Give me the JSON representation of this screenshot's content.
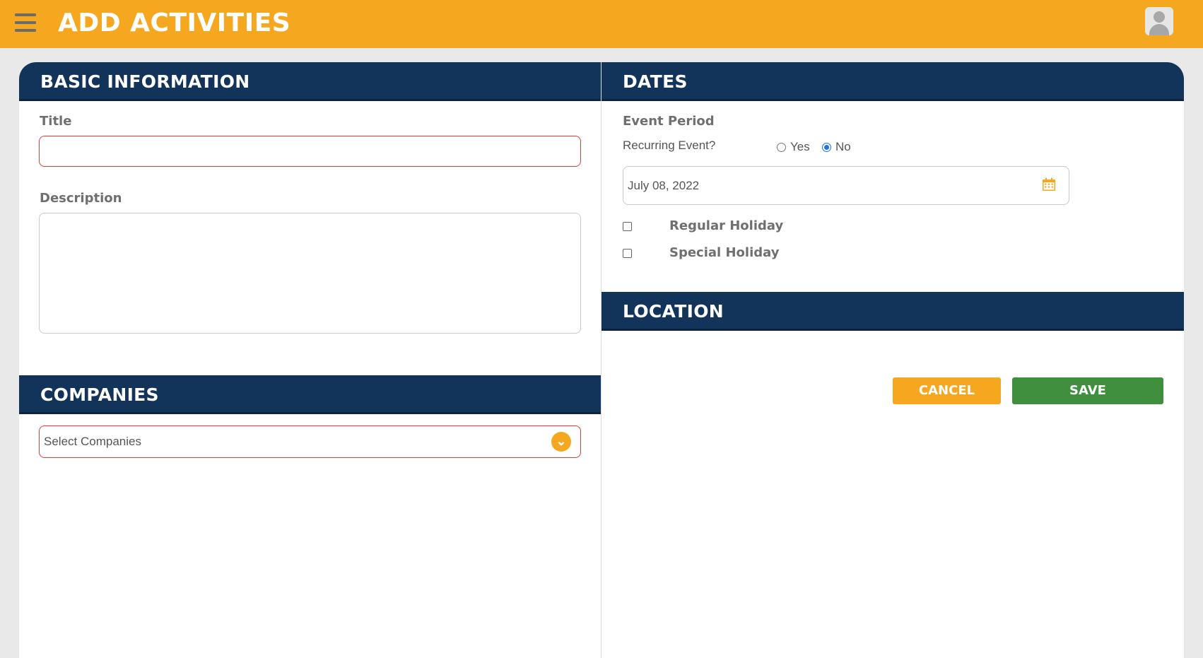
{
  "header": {
    "title": "ADD ACTIVITIES",
    "menu_icon": "hamburger-menu-icon",
    "avatar_icon": "user-avatar-icon"
  },
  "basic_information": {
    "heading": "BASIC INFORMATION",
    "title_label": "Title",
    "title_value": "",
    "description_label": "Description",
    "description_value": ""
  },
  "companies": {
    "heading": "COMPANIES",
    "select_placeholder": "Select Companies",
    "dropdown_icon": "chevron-down-icon"
  },
  "dates": {
    "heading": "DATES",
    "event_period_label": "Event Period",
    "recurring_label": "Recurring Event?",
    "recurring_options": [
      {
        "label": "Yes",
        "checked": false
      },
      {
        "label": "No",
        "checked": true
      }
    ],
    "date_value": "July 08, 2022",
    "calendar_icon": "calendar-icon",
    "holidays": [
      {
        "label": "Regular Holiday",
        "checked": false
      },
      {
        "label": "Special Holiday",
        "checked": false
      }
    ]
  },
  "location": {
    "heading": "LOCATION"
  },
  "actions": {
    "cancel_label": "CANCEL",
    "save_label": "SAVE"
  },
  "colors": {
    "topbar": "#f5a81f",
    "section_header": "#12335a",
    "cancel_button": "#f5a81f",
    "save_button": "#3f8f3f",
    "required_border": "#e23b3b"
  }
}
